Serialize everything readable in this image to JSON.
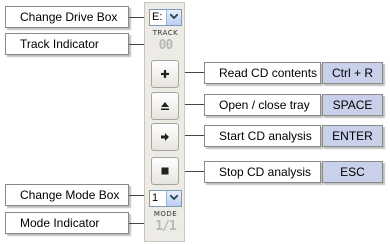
{
  "callouts": {
    "change_drive_box": "Change Drive Box",
    "track_indicator": "Track Indicator",
    "read_cd": "Read CD contents",
    "open_close": "Open / close tray",
    "start_analysis": "Start CD analysis",
    "stop_analysis": "Stop CD analysis",
    "change_mode_box": "Change Mode Box",
    "mode_indicator": "Mode Indicator"
  },
  "shortcuts": {
    "read_cd": "Ctrl + R",
    "open_close": "SPACE",
    "start_analysis": "ENTER",
    "stop_analysis": "ESC"
  },
  "panel": {
    "drive_value": "E:",
    "track_caption": "TRACK",
    "track_value": "00",
    "mode_value": "1",
    "mode_caption": "MODE",
    "mode_indicator_value": "1/1"
  },
  "icons": {
    "read": "plus-icon",
    "eject": "eject-icon",
    "start": "arrow-right-icon",
    "stop": "stop-icon"
  },
  "colors": {
    "key_background": "#c9d0e9",
    "panel_background": "#ecebe6"
  }
}
